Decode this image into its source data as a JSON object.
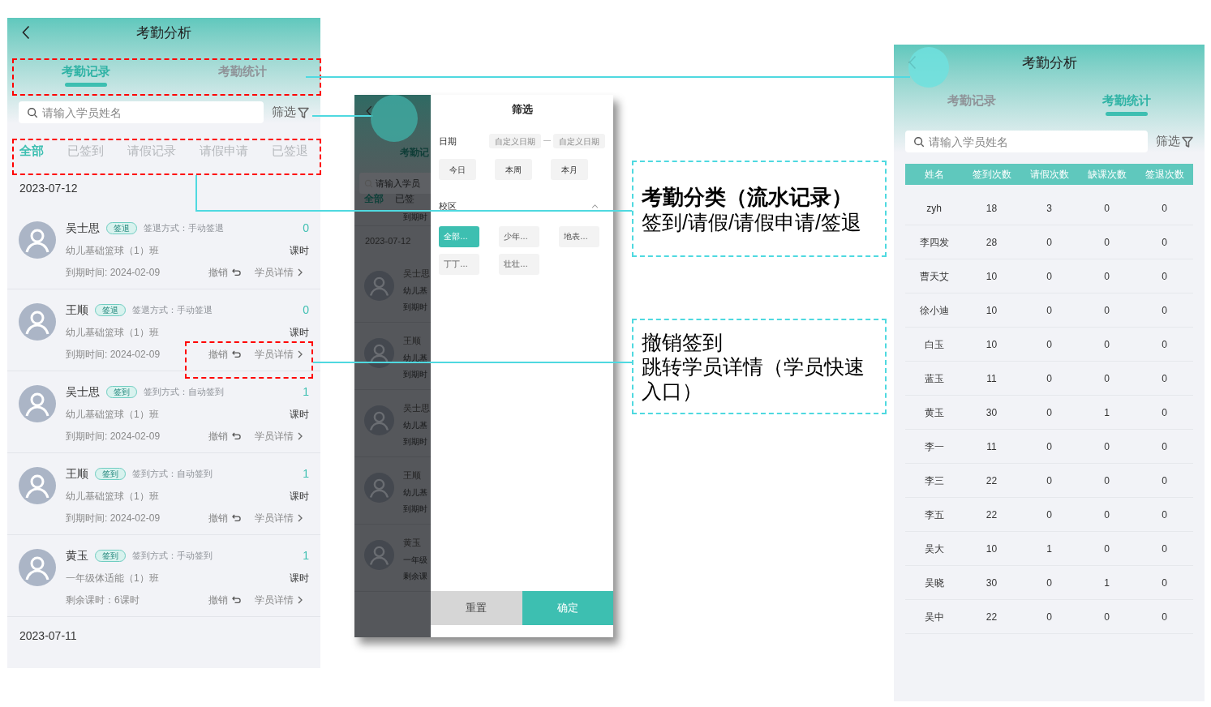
{
  "records_screen": {
    "title": "考勤分析",
    "tabs": [
      {
        "label": "考勤记录",
        "selected": true
      },
      {
        "label": "考勤统计",
        "selected": false
      }
    ],
    "search": {
      "placeholder": "请输入学员姓名"
    },
    "filter_label": "筛选",
    "categories": [
      {
        "label": "全部",
        "selected": true
      },
      {
        "label": "已签到",
        "selected": false
      },
      {
        "label": "请假记录",
        "selected": false
      },
      {
        "label": "请假申请",
        "selected": false
      },
      {
        "label": "已签退",
        "selected": false
      }
    ],
    "groups": [
      {
        "date": "2023-07-12",
        "records": [
          {
            "name": "吴士思",
            "badge": "签退",
            "method": "签退方式：手动签退",
            "class": "幼儿基础篮球（1）班",
            "info": "到期时间: 2024-02-09",
            "count": "0",
            "unit": "课时",
            "undo": "撤销",
            "detail": "学员详情"
          },
          {
            "name": "王顺",
            "badge": "签退",
            "method": "签退方式：手动签退",
            "class": "幼儿基础篮球（1）班",
            "info": "到期时间: 2024-02-09",
            "count": "0",
            "unit": "课时",
            "undo": "撤销",
            "detail": "学员详情"
          },
          {
            "name": "吴士思",
            "badge": "签到",
            "method": "签到方式：自动签到",
            "class": "幼儿基础篮球（1）班",
            "info": "到期时间: 2024-02-09",
            "count": "1",
            "unit": "课时",
            "undo": "撤销",
            "detail": "学员详情"
          },
          {
            "name": "王顺",
            "badge": "签到",
            "method": "签到方式：自动签到",
            "class": "幼儿基础篮球（1）班",
            "info": "到期时间: 2024-02-09",
            "count": "1",
            "unit": "课时",
            "undo": "撤销",
            "detail": "学员详情"
          },
          {
            "name": "黄玉",
            "badge": "签到",
            "method": "签到方式：手动签到",
            "class": "一年级体适能（1）班",
            "info": "剩余课时：6课时",
            "count": "1",
            "unit": "课时",
            "undo": "撤销",
            "detail": "学员详情"
          }
        ]
      },
      {
        "date": "2023-07-11"
      }
    ]
  },
  "filter_screen": {
    "background": {
      "tab": "考勤记",
      "search": "请输入学员",
      "categories": [
        {
          "label": "全部",
          "selected": true
        },
        {
          "label": "已签",
          "selected": false
        }
      ],
      "top_line": "到期时",
      "date": "2023-07-12",
      "rows": [
        {
          "name": "吴士思",
          "line2": "幼儿基",
          "line3": "到期时"
        },
        {
          "name": "王顺",
          "line2": "幼儿基",
          "line3": "到期时"
        },
        {
          "name": "吴士思",
          "line2": "幼儿基",
          "line3": "到期时"
        },
        {
          "name": "王顺",
          "line2": "幼儿基",
          "line3": "到期时"
        },
        {
          "name": "黄玉",
          "line2": "一年级",
          "line3": "剩余课"
        }
      ]
    },
    "drawer": {
      "title": "筛选",
      "date_label": "日期",
      "date_fields": [
        {
          "placeholder": "自定义日期"
        },
        {
          "placeholder": "自定义日期"
        }
      ],
      "date_separator": "—",
      "quick_dates": [
        "今日",
        "本周",
        "本月"
      ],
      "campus_label": "校区",
      "campus_options": [
        {
          "label": "全部…",
          "selected": true
        },
        {
          "label": "少年…",
          "selected": false
        },
        {
          "label": "地表…",
          "selected": false
        },
        {
          "label": "丁丁…",
          "selected": false
        },
        {
          "label": "壮壮…",
          "selected": false
        }
      ],
      "reset": "重置",
      "confirm": "确定"
    }
  },
  "annotations": [
    {
      "title": "考勤分类（流水记录）",
      "lines": [
        "签到/请假/请假申请/签退"
      ]
    },
    {
      "lines": [
        "撤销签到",
        "跳转学员详情（学员快速入口）"
      ]
    }
  ],
  "stats_screen": {
    "title": "考勤分析",
    "tabs": [
      {
        "label": "考勤记录",
        "selected": false
      },
      {
        "label": "考勤统计",
        "selected": true
      }
    ],
    "search": {
      "placeholder": "请输入学员姓名"
    },
    "filter_label": "筛选",
    "table": {
      "columns": [
        "姓名",
        "签到次数",
        "请假次数",
        "缺课次数",
        "签退次数"
      ],
      "rows": [
        [
          "zyh",
          "18",
          "3",
          "0",
          "0"
        ],
        [
          "李四发",
          "28",
          "0",
          "0",
          "0"
        ],
        [
          "曹天艾",
          "10",
          "0",
          "0",
          "0"
        ],
        [
          "徐小迪",
          "10",
          "0",
          "0",
          "0"
        ],
        [
          "白玉",
          "10",
          "0",
          "0",
          "0"
        ],
        [
          "蓝玉",
          "11",
          "0",
          "0",
          "0"
        ],
        [
          "黄玉",
          "30",
          "0",
          "1",
          "0"
        ],
        [
          "李一",
          "11",
          "0",
          "0",
          "0"
        ],
        [
          "李三",
          "22",
          "0",
          "0",
          "0"
        ],
        [
          "李五",
          "22",
          "0",
          "0",
          "0"
        ],
        [
          "吴大",
          "10",
          "1",
          "0",
          "0"
        ],
        [
          "吴晓",
          "30",
          "0",
          "1",
          "0"
        ],
        [
          "吴中",
          "22",
          "0",
          "0",
          "0"
        ]
      ]
    }
  }
}
